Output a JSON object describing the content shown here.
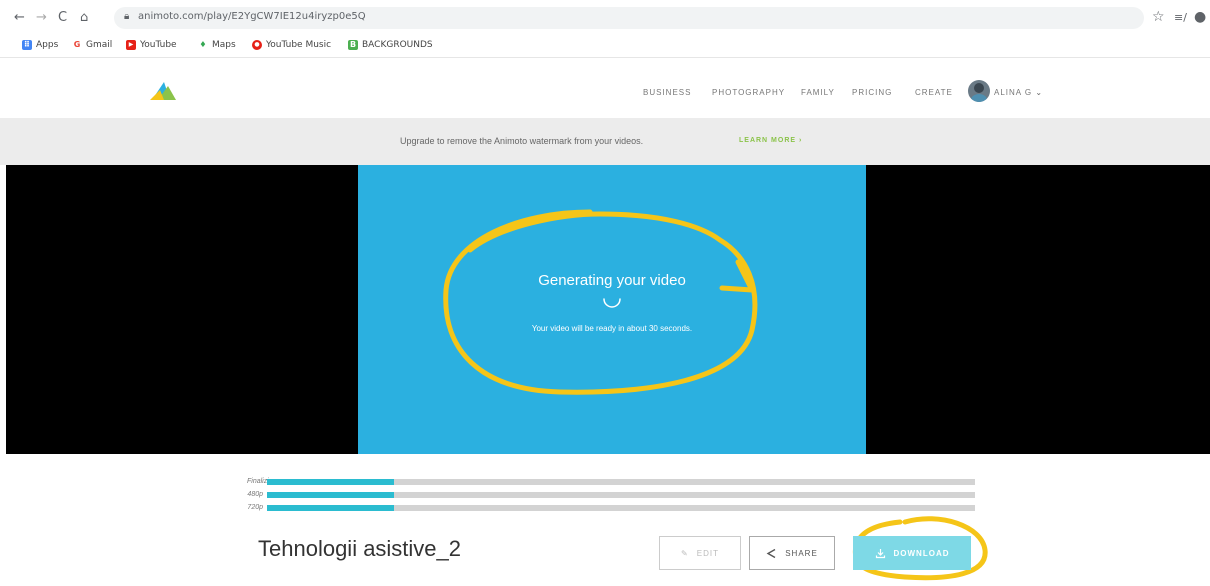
{
  "browser": {
    "back": "←",
    "forward": "→",
    "reload": "C",
    "home": "⌂",
    "url": "animoto.com/play/E2YgCW7IE12u4iryzp0e5Q",
    "star": "☆",
    "reading_list": "≡/",
    "profile": "●",
    "menu": "⋮"
  },
  "bookmarks": [
    {
      "label": "Apps",
      "icon": "apps-grid-icon",
      "color": "#4285f4",
      "glyph": "⠿"
    },
    {
      "label": "Gmail",
      "icon": "google-icon",
      "color": "#ea4335",
      "glyph": "G"
    },
    {
      "label": "YouTube",
      "icon": "youtube-icon",
      "color": "#e62117",
      "glyph": "▶"
    },
    {
      "label": "Maps",
      "icon": "maps-pin-icon",
      "color": "#34a853",
      "glyph": "♦"
    },
    {
      "label": "YouTube Music",
      "icon": "youtube-music-icon",
      "color": "#e62117",
      "glyph": "●"
    },
    {
      "label": "BACKGROUNDS",
      "icon": "bookmark-page-icon",
      "color": "#4caf50",
      "glyph": "B"
    }
  ],
  "site_nav": {
    "items": [
      "BUSINESS",
      "PHOTOGRAPHY",
      "FAMILY",
      "PRICING",
      "CREATE"
    ],
    "user": "ALINA G"
  },
  "banner": {
    "text": "Upgrade to remove the Animoto watermark from your videos.",
    "link": "LEARN MORE ›"
  },
  "player": {
    "title": "Generating your video",
    "subtitle": "Your video will be ready in about 30 seconds."
  },
  "progress": [
    {
      "label": "Finalizing",
      "fraction": 0.18
    },
    {
      "label": "480p",
      "fraction": 0.18
    },
    {
      "label": "720p",
      "fraction": 0.18
    }
  ],
  "video": {
    "title": "Tehnologii asistive_2"
  },
  "actions": {
    "edit": "EDIT",
    "share": "SHARE",
    "download": "DOWNLOAD"
  },
  "colors": {
    "accent": "#2bb0e0",
    "progress": "#2bbcd0",
    "annotation": "#f5c518",
    "learn_more": "#8bc34a"
  }
}
